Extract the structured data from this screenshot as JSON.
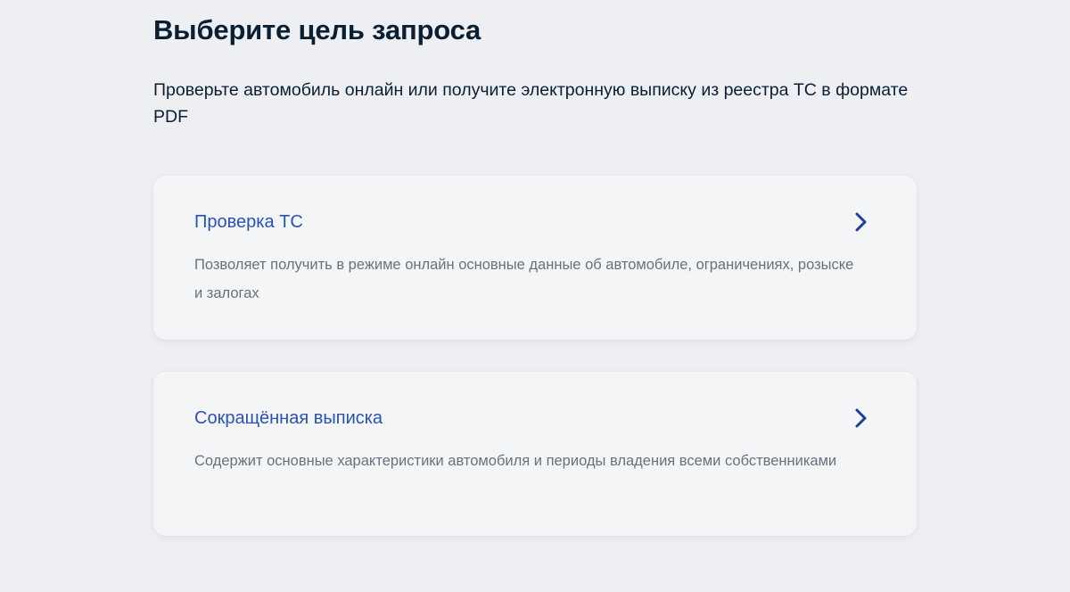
{
  "page": {
    "title": "Выберите цель запроса",
    "subtitle": "Проверьте автомобиль онлайн или получите электронную выписку из реестра ТС в формате PDF"
  },
  "options": [
    {
      "title": "Проверка ТС",
      "description": "Позволяет получить в режиме онлайн основные данные об автомобиле, ограничениях, розыске и залогах",
      "icon": "chevron-right-icon"
    },
    {
      "title": "Сокращённая выписка",
      "description": "Содержит основные характеристики автомобиля и периоды владения всеми собственниками",
      "icon": "chevron-right-icon"
    }
  ],
  "colors": {
    "background": "#edeff3",
    "card": "#f4f5f7",
    "title_text": "#0b1f33",
    "link": "#2a52b5",
    "muted_text": "#66727f",
    "chevron": "#1d3f9a"
  }
}
